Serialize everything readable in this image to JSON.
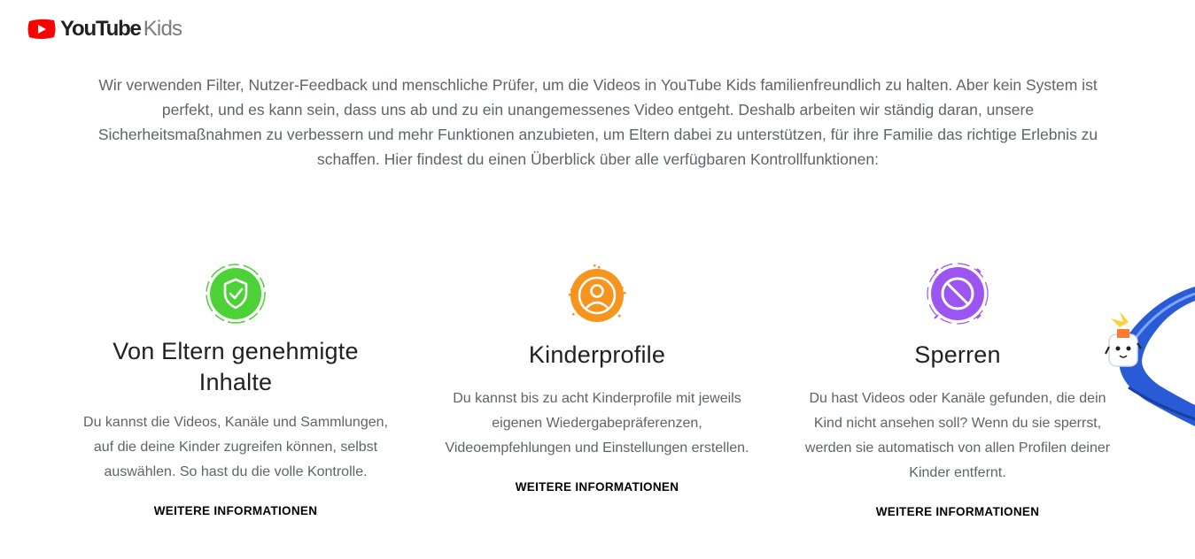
{
  "header": {
    "logo_youtube": "YouTube",
    "logo_kids": "Kids"
  },
  "intro": {
    "text": "Wir verwenden Filter, Nutzer-Feedback und menschliche Prüfer, um die Videos in YouTube Kids familienfreundlich zu halten. Aber kein System ist perfekt, und es kann sein, dass uns ab und zu ein unangemessenes Video entgeht. Deshalb arbeiten wir ständig daran, unsere Sicherheitsmaßnahmen zu verbessern und mehr Funktionen anzubieten, um Eltern dabei zu unterstützen, für ihre Familie das richtige Erlebnis zu schaffen. Hier findest du einen Überblick über alle verfügbaren Kontrollfunktionen:"
  },
  "features": [
    {
      "title": "Von Eltern genehmigte Inhalte",
      "description": "Du kannst die Videos, Kanäle und Sammlungen, auf die deine Kinder zugreifen können, selbst auswählen. So hast du die volle Kontrolle.",
      "link": "WEITERE INFORMATIONEN",
      "icon": "shield-check-icon",
      "color": "#4cd137"
    },
    {
      "title": "Kinderprofile",
      "description": "Du kannst bis zu acht Kinderprofile mit jeweils eigenen Wiedergabepräferenzen, Videoempfehlungen und Einstellungen erstellen.",
      "link": "WEITERE INFORMATIONEN",
      "icon": "profile-icon",
      "color": "#f7941d"
    },
    {
      "title": "Sperren",
      "description": "Du hast Videos oder Kanäle gefunden, die dein Kind nicht ansehen soll? Wenn du sie sperrst, werden sie automatisch von allen Profilen deiner Kinder entfernt.",
      "link": "WEITERE INFORMATIONEN",
      "icon": "block-icon",
      "color": "#9c55f0"
    }
  ],
  "colors": {
    "brand_red": "#ff0000",
    "text_muted": "#5f6368",
    "heading": "#212121"
  }
}
